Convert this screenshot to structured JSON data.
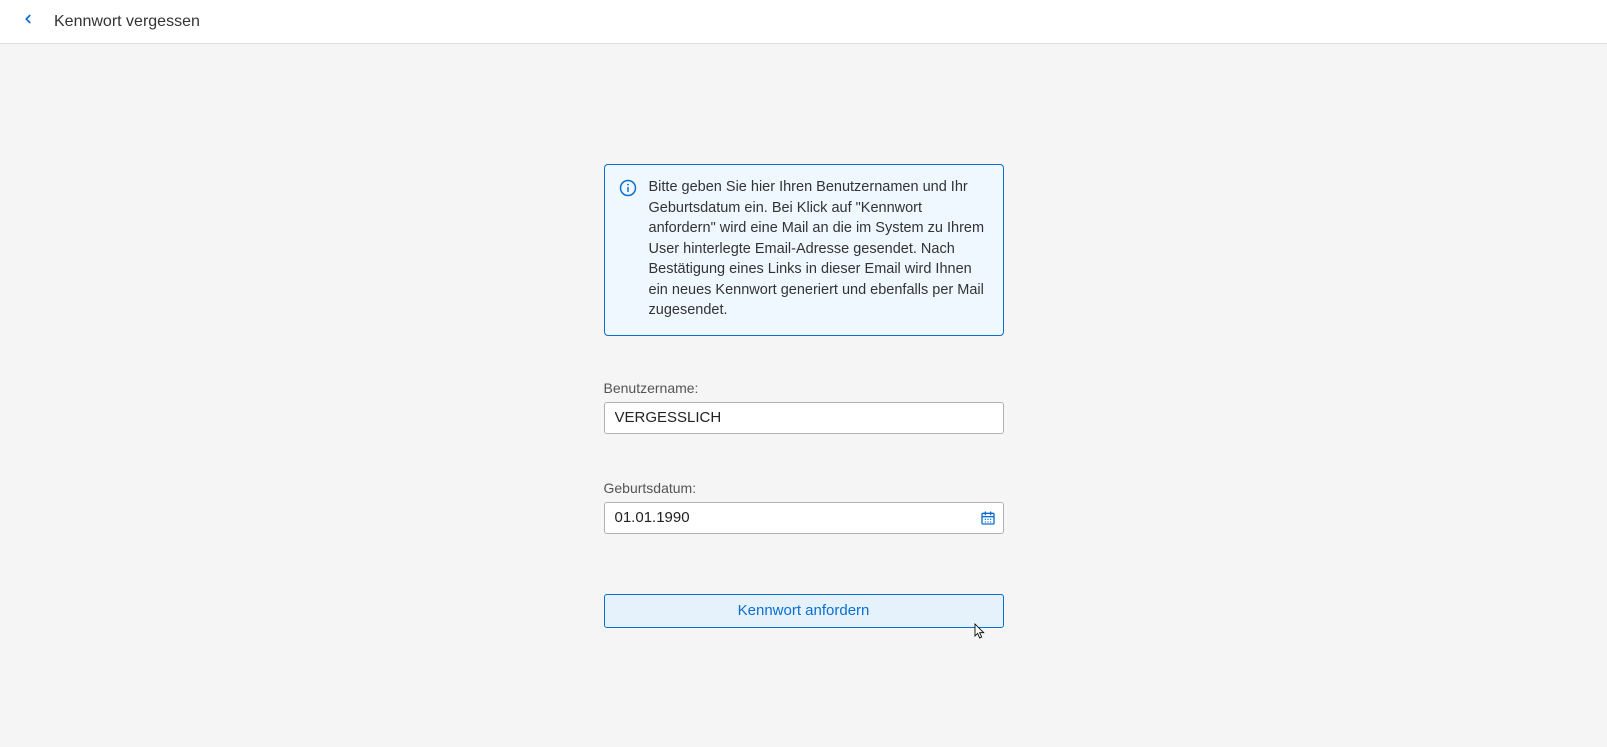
{
  "header": {
    "title": "Kennwort vergessen"
  },
  "info": {
    "text": "Bitte geben Sie hier Ihren Benutzernamen und Ihr Geburtsdatum ein. Bei Klick auf \"Kennwort anfordern\" wird eine Mail an die im System zu Ihrem User hinterlegte Email-Adresse gesendet. Nach Bestätigung eines Links in dieser Email wird Ihnen ein neues Kennwort generiert und ebenfalls per Mail zugesendet."
  },
  "fields": {
    "username": {
      "label": "Benutzername:",
      "value": "VERGESSLICH"
    },
    "birthdate": {
      "label": "Geburtsdatum:",
      "value": "01.01.1990"
    }
  },
  "button": {
    "submit": "Kennwort anfordern"
  }
}
